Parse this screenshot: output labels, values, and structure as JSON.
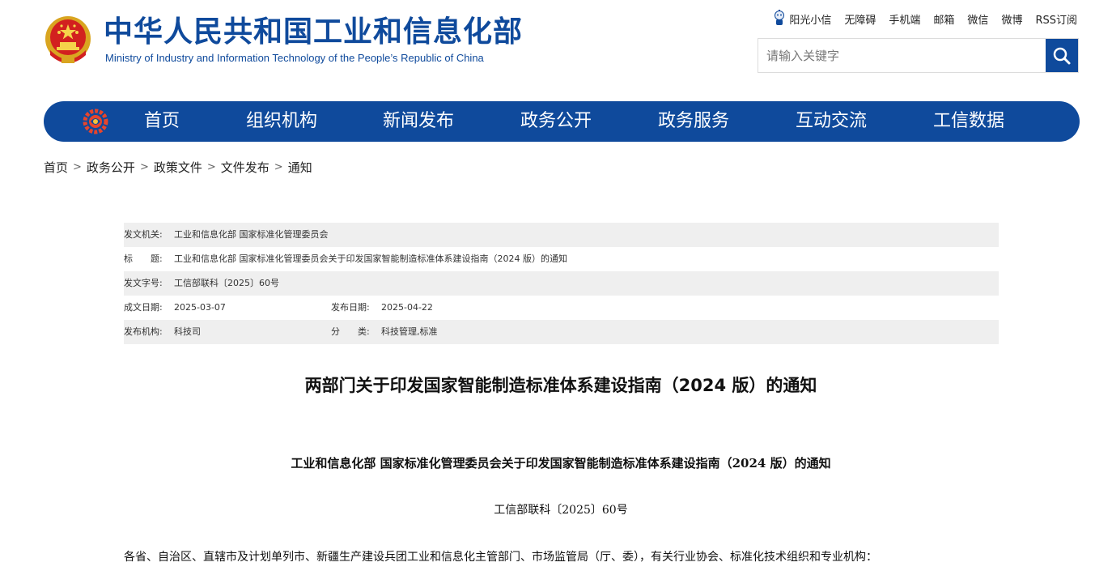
{
  "header": {
    "title_cn": "中华人民共和国工业和信息化部",
    "title_en": "Ministry of Industry and Information Technology of the People’s Republic of China",
    "emblem_icon": "national-emblem-icon",
    "brand_color": "#0f4a9c"
  },
  "toplinks": [
    "阳光小信",
    "无障碍",
    "手机端",
    "邮箱",
    "微信",
    "微博",
    "RSS订阅"
  ],
  "search": {
    "placeholder": "请输入关键字",
    "value": "",
    "icon": "search-icon"
  },
  "nav": {
    "items": [
      "首页",
      "组织机构",
      "新闻发布",
      "政务公开",
      "政务服务",
      "互动交流",
      "工信数据"
    ],
    "logo_icon": "miit-logo-icon"
  },
  "breadcrumb": {
    "items": [
      "首页",
      "政务公开",
      "政策文件",
      "文件发布",
      "通知"
    ],
    "separator": ">"
  },
  "info": {
    "issuer_label": "发文机关:",
    "issuer": "工业和信息化部 国家标准化管理委员会",
    "title_label": "标　　题:",
    "title": "工业和信息化部 国家标准化管理委员会关于印发国家智能制造标准体系建设指南（2024 版）的通知",
    "docno_label": "发文字号:",
    "docno": "工信部联科〔2025〕60号",
    "written_label": "成文日期:",
    "written": "2025-03-07",
    "published_label": "发布日期:",
    "published": "2025-04-22",
    "org_label": "发布机构:",
    "org": "科技司",
    "category_label": "分　　类:",
    "category": "科技管理,标准"
  },
  "article": {
    "title": "两部门关于印发国家智能制造标准体系建设指南（2024 版）的通知",
    "subtitle": "工业和信息化部 国家标准化管理委员会关于印发国家智能制造标准体系建设指南（2024 版）的通知",
    "docno": "工信部联科〔2025〕60号",
    "para1": "各省、自治区、直辖市及计划单列市、新疆生产建设兵团工业和信息化主管部门、市场监管局（厅、委），有关行业协会、标准化技术组织和专业机构："
  }
}
